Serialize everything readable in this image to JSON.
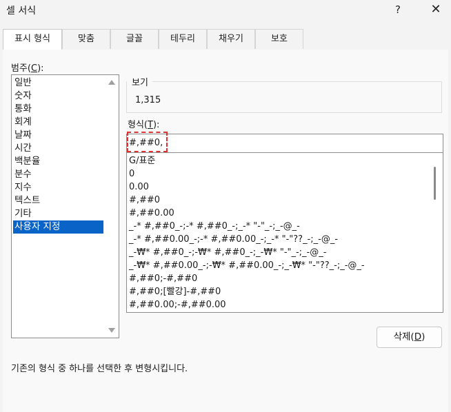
{
  "window": {
    "title": "셀 서식",
    "help": "?",
    "close": "✕"
  },
  "tabs": [
    {
      "label": "표시 형식"
    },
    {
      "label": "맞춤"
    },
    {
      "label": "글꼴"
    },
    {
      "label": "테두리"
    },
    {
      "label": "채우기"
    },
    {
      "label": "보호"
    }
  ],
  "category": {
    "label_pre": "범주(",
    "label_key": "C",
    "label_post": "):",
    "items": [
      "일반",
      "숫자",
      "통화",
      "회계",
      "날짜",
      "시간",
      "백분율",
      "분수",
      "지수",
      "텍스트",
      "기타",
      "사용자 지정"
    ],
    "selected": "사용자 지정"
  },
  "preview": {
    "label": "보기",
    "value": "1,315"
  },
  "format": {
    "label_pre": "형식(",
    "label_key": "T",
    "label_post": "):",
    "value": "#,##0,",
    "options": [
      "G/표준",
      "0",
      "0.00",
      "#,##0",
      "#,##0.00",
      "_-* #,##0_-;-* #,##0_-;_-* \"-\"_-;_-@_-",
      "_-* #,##0.00_-;-* #,##0.00_-;_-* \"-\"??_-;_-@_-",
      "_-₩* #,##0_-;-₩* #,##0_-;_-₩* \"-\"_-;_-@_-",
      "_-₩* #,##0.00_-;-₩* #,##0.00_-;_-₩* \"-\"??_-;_-@_-",
      "#,##0;-#,##0",
      "#,##0;[빨강]-#,##0",
      "#,##0.00;-#,##0.00"
    ]
  },
  "delete_button": {
    "label_pre": "삭제(",
    "label_key": "D",
    "label_post": ")"
  },
  "description": "기존의 형식 중 하나를 선택한 후 변형시킵니다."
}
